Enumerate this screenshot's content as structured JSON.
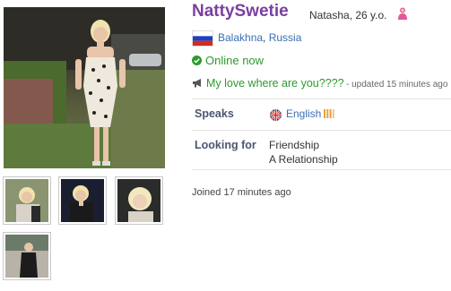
{
  "profile": {
    "username": "NattySwetie",
    "name_age": "Natasha, 26 y.o.",
    "gender_icon": "female-user-icon",
    "location": {
      "city": "Balakhna",
      "separator": ", ",
      "country": "Russia",
      "flag_icon": "russia-flag-icon"
    },
    "online_status": "Online now",
    "status_message": "My love where are you????",
    "status_updated": "- updated 15 minutes ago",
    "speaks": {
      "label": "Speaks",
      "language": "English",
      "language_icon": "uk-flag-icon",
      "level_icon": "language-level-bars-icon"
    },
    "looking_for": {
      "label": "Looking for",
      "items": [
        "Friendship",
        "A Relationship"
      ]
    },
    "joined": "Joined 17 minutes ago"
  },
  "photos": {
    "main": "profile-main-photo",
    "thumbnails": [
      "profile-thumbnail-1",
      "profile-thumbnail-2",
      "profile-thumbnail-3",
      "profile-thumbnail-4"
    ]
  },
  "colors": {
    "username": "#7b3fa0",
    "online": "#2d9a2d",
    "link": "#3a6fb0",
    "label": "#4a5670"
  }
}
